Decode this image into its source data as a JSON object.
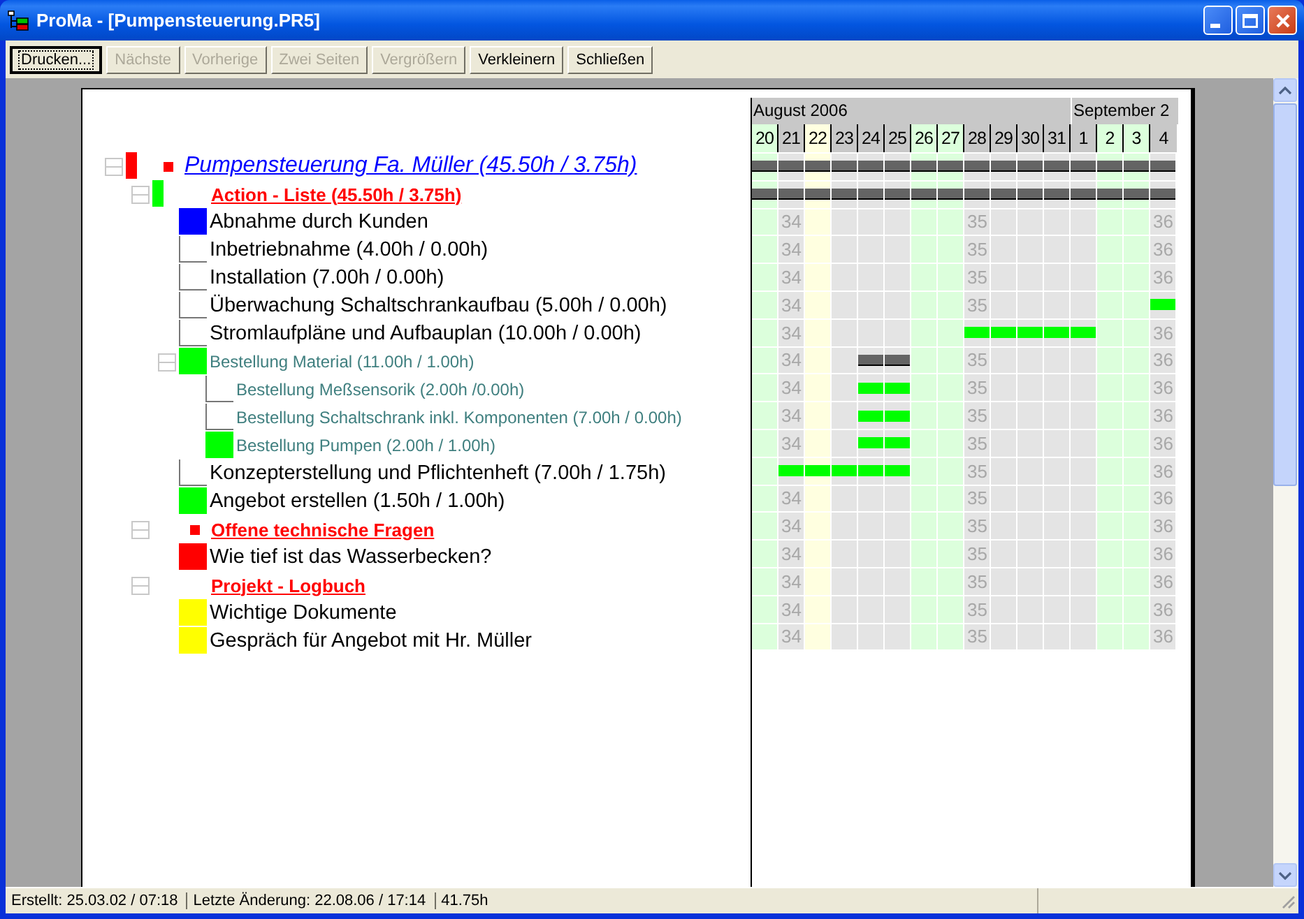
{
  "window": {
    "title": "ProMa - [Pumpensteuerung.PR5]"
  },
  "toolbar": [
    {
      "label": "Drucken...",
      "disabled": false,
      "focused": true
    },
    {
      "label": "Nächste",
      "disabled": true,
      "focused": false
    },
    {
      "label": "Vorherige",
      "disabled": true,
      "focused": false
    },
    {
      "label": "Zwei Seiten",
      "disabled": true,
      "focused": false
    },
    {
      "label": "Vergrößern",
      "disabled": true,
      "focused": false
    },
    {
      "label": "Verkleinern",
      "disabled": false,
      "focused": false
    },
    {
      "label": "Schließen",
      "disabled": false,
      "focused": false
    }
  ],
  "tree": [
    {
      "label": "Pumpensteuerung Fa. Müller (45.50h / 3.75h)",
      "kind": "project",
      "color": "#ff0000",
      "flag": true,
      "expanded": true,
      "children": [
        {
          "label": "Action - Liste (45.50h / 3.75h)",
          "kind": "section",
          "color": "#00ff00",
          "expanded": true,
          "children": [
            {
              "label": "Abnahme durch Kunden",
              "kind": "task",
              "color": "#0000ff"
            },
            {
              "label": "Inbetriebnahme (4.00h / 0.00h)",
              "kind": "task"
            },
            {
              "label": "Installation (7.00h / 0.00h)",
              "kind": "task"
            },
            {
              "label": "Überwachung Schaltschrankaufbau (5.00h / 0.00h)",
              "kind": "task"
            },
            {
              "label": "Stromlaufpläne und Aufbauplan (10.00h / 0.00h)",
              "kind": "task"
            },
            {
              "label": "Bestellung Material (11.00h / 1.00h)",
              "kind": "subtask",
              "color": "#00ff00",
              "expanded": true,
              "children": [
                {
                  "label": "Bestellung Meßsensorik (2.00h /0.00h)",
                  "kind": "subtask"
                },
                {
                  "label": "Bestellung Schaltschrank inkl. Komponenten (7.00h / 0.00h)",
                  "kind": "subtask"
                },
                {
                  "label": "Bestellung Pumpen (2.00h / 1.00h)",
                  "kind": "subtask",
                  "color": "#00ff00"
                }
              ]
            },
            {
              "label": "Konzepterstellung und Pflichtenheft (7.00h / 1.75h)",
              "kind": "task"
            },
            {
              "label": "Angebot erstellen (1.50h / 1.00h)",
              "kind": "task",
              "color": "#00ff00"
            }
          ]
        },
        {
          "label": "Offene technische Fragen",
          "kind": "section",
          "flag": true,
          "expanded": true,
          "children": [
            {
              "label": "Wie tief ist das Wasserbecken?",
              "kind": "task",
              "color": "#ff0000"
            }
          ]
        },
        {
          "label": "Projekt - Logbuch",
          "kind": "section",
          "expanded": true,
          "children": [
            {
              "label": "Wichtige Dokumente",
              "kind": "task",
              "color": "#ffff00"
            },
            {
              "label": "Gespräch für Angebot mit Hr. Müller",
              "kind": "task",
              "color": "#ffff00"
            }
          ]
        }
      ]
    }
  ],
  "gantt": {
    "months": [
      {
        "label": "August 2006",
        "days": [
          {
            "label": "20",
            "kind": "weekend"
          },
          {
            "label": "21",
            "kind": "workday"
          },
          {
            "label": "22",
            "kind": "today"
          },
          {
            "label": "23",
            "kind": "workday"
          },
          {
            "label": "24",
            "kind": "workday"
          },
          {
            "label": "25",
            "kind": "workday"
          },
          {
            "label": "26",
            "kind": "weekend"
          },
          {
            "label": "27",
            "kind": "weekend"
          },
          {
            "label": "28",
            "kind": "workday"
          },
          {
            "label": "29",
            "kind": "workday"
          },
          {
            "label": "30",
            "kind": "workday"
          },
          {
            "label": "31",
            "kind": "workday"
          }
        ]
      },
      {
        "label": "September 2",
        "days": [
          {
            "label": "1",
            "kind": "workday"
          },
          {
            "label": "2",
            "kind": "weekend"
          },
          {
            "label": "3",
            "kind": "weekend"
          },
          {
            "label": "4",
            "kind": "workday"
          }
        ]
      }
    ],
    "rows": [
      {
        "cells": [
          {
            "kind": "summary"
          },
          {
            "kind": "summary"
          },
          {
            "kind": "summary"
          },
          {
            "kind": "summary"
          },
          {
            "kind": "summary"
          },
          {
            "kind": "summary"
          },
          {
            "kind": "summary"
          },
          {
            "kind": "summary"
          },
          {
            "kind": "summary"
          },
          {
            "kind": "summary"
          },
          {
            "kind": "summary"
          },
          {
            "kind": "summary"
          },
          {
            "kind": "summary"
          },
          {
            "kind": "summary"
          },
          {
            "kind": "summary"
          },
          {
            "kind": "summary"
          }
        ]
      },
      {
        "cells": [
          {
            "kind": "summary"
          },
          {
            "kind": "summary"
          },
          {
            "kind": "summary"
          },
          {
            "kind": "summary"
          },
          {
            "kind": "summary"
          },
          {
            "kind": "summary"
          },
          {
            "kind": "summary"
          },
          {
            "kind": "summary"
          },
          {
            "kind": "summary"
          },
          {
            "kind": "summary"
          },
          {
            "kind": "summary"
          },
          {
            "kind": "summary"
          },
          {
            "kind": "summary"
          },
          {
            "kind": "summary"
          },
          {
            "kind": "summary"
          },
          {
            "kind": "summary"
          }
        ]
      },
      {
        "week_labels": [
          "34",
          "35",
          "36"
        ]
      },
      {
        "week_labels": [
          "34",
          "35",
          "36"
        ]
      },
      {
        "week_labels": [
          "34",
          "35",
          "36"
        ]
      },
      {
        "week_labels": [
          "34",
          "35"
        ],
        "cells": [
          {
            "kind": "none"
          },
          {
            "kind": "none"
          },
          {
            "kind": "none"
          },
          {
            "kind": "none"
          },
          {
            "kind": "none"
          },
          {
            "kind": "none"
          },
          {
            "kind": "none"
          },
          {
            "kind": "none"
          },
          {
            "kind": "none"
          },
          {
            "kind": "none"
          },
          {
            "kind": "none"
          },
          {
            "kind": "none"
          },
          {
            "kind": "none"
          },
          {
            "kind": "none"
          },
          {
            "kind": "none"
          },
          {
            "kind": "task"
          }
        ]
      },
      {
        "week_labels": [
          "34",
          "36"
        ],
        "cells": [
          {
            "kind": "none"
          },
          {
            "kind": "none"
          },
          {
            "kind": "none"
          },
          {
            "kind": "none"
          },
          {
            "kind": "none"
          },
          {
            "kind": "none"
          },
          {
            "kind": "none"
          },
          {
            "kind": "none"
          },
          {
            "kind": "task"
          },
          {
            "kind": "task"
          },
          {
            "kind": "task"
          },
          {
            "kind": "task"
          },
          {
            "kind": "task"
          },
          {
            "kind": "none"
          },
          {
            "kind": "none"
          },
          {
            "kind": "none"
          }
        ]
      },
      {
        "week_labels": [
          "34",
          "35",
          "36"
        ],
        "cells": [
          {
            "kind": "none"
          },
          {
            "kind": "none"
          },
          {
            "kind": "none"
          },
          {
            "kind": "none"
          },
          {
            "kind": "summary"
          },
          {
            "kind": "summary"
          },
          {
            "kind": "none"
          },
          {
            "kind": "none"
          },
          {
            "kind": "none"
          },
          {
            "kind": "none"
          },
          {
            "kind": "none"
          },
          {
            "kind": "none"
          },
          {
            "kind": "none"
          },
          {
            "kind": "none"
          },
          {
            "kind": "none"
          },
          {
            "kind": "none"
          }
        ]
      },
      {
        "week_labels": [
          "34",
          "35",
          "36"
        ],
        "cells": [
          {
            "kind": "none"
          },
          {
            "kind": "none"
          },
          {
            "kind": "none"
          },
          {
            "kind": "none"
          },
          {
            "kind": "task"
          },
          {
            "kind": "task"
          },
          {
            "kind": "none"
          },
          {
            "kind": "none"
          },
          {
            "kind": "none"
          },
          {
            "kind": "none"
          },
          {
            "kind": "none"
          },
          {
            "kind": "none"
          },
          {
            "kind": "none"
          },
          {
            "kind": "none"
          },
          {
            "kind": "none"
          },
          {
            "kind": "none"
          }
        ]
      },
      {
        "week_labels": [
          "34",
          "35",
          "36"
        ],
        "cells": [
          {
            "kind": "none"
          },
          {
            "kind": "none"
          },
          {
            "kind": "none"
          },
          {
            "kind": "none"
          },
          {
            "kind": "task"
          },
          {
            "kind": "task"
          },
          {
            "kind": "none"
          },
          {
            "kind": "none"
          },
          {
            "kind": "none"
          },
          {
            "kind": "none"
          },
          {
            "kind": "none"
          },
          {
            "kind": "none"
          },
          {
            "kind": "none"
          },
          {
            "kind": "none"
          },
          {
            "kind": "none"
          },
          {
            "kind": "none"
          }
        ]
      },
      {
        "week_labels": [
          "34",
          "35",
          "36"
        ],
        "cells": [
          {
            "kind": "none"
          },
          {
            "kind": "none"
          },
          {
            "kind": "none"
          },
          {
            "kind": "none"
          },
          {
            "kind": "task"
          },
          {
            "kind": "task"
          },
          {
            "kind": "none"
          },
          {
            "kind": "none"
          },
          {
            "kind": "none"
          },
          {
            "kind": "none"
          },
          {
            "kind": "none"
          },
          {
            "kind": "none"
          },
          {
            "kind": "none"
          },
          {
            "kind": "none"
          },
          {
            "kind": "none"
          },
          {
            "kind": "none"
          }
        ]
      },
      {
        "week_labels": [
          "35",
          "36"
        ],
        "cells": [
          {
            "kind": "none"
          },
          {
            "kind": "task"
          },
          {
            "kind": "task"
          },
          {
            "kind": "task"
          },
          {
            "kind": "task"
          },
          {
            "kind": "task"
          },
          {
            "kind": "none"
          },
          {
            "kind": "none"
          },
          {
            "kind": "none"
          },
          {
            "kind": "none"
          },
          {
            "kind": "none"
          },
          {
            "kind": "none"
          },
          {
            "kind": "none"
          },
          {
            "kind": "none"
          },
          {
            "kind": "none"
          },
          {
            "kind": "none"
          }
        ]
      },
      {
        "week_labels": [
          "34",
          "35",
          "36"
        ]
      },
      {
        "week_labels": [
          "34",
          "35",
          "36"
        ]
      },
      {
        "week_labels": [
          "34",
          "35",
          "36"
        ]
      },
      {
        "week_labels": [
          "34",
          "35",
          "36"
        ]
      },
      {
        "week_labels": [
          "34",
          "35",
          "36"
        ]
      },
      {
        "week_labels": [
          "34",
          "35",
          "36"
        ]
      }
    ]
  },
  "status_bar": [
    "Erstellt: 25.03.02 / 07:18",
    "Letzte Änderung: 22.08.06 / 17:14",
    "41.75h"
  ]
}
